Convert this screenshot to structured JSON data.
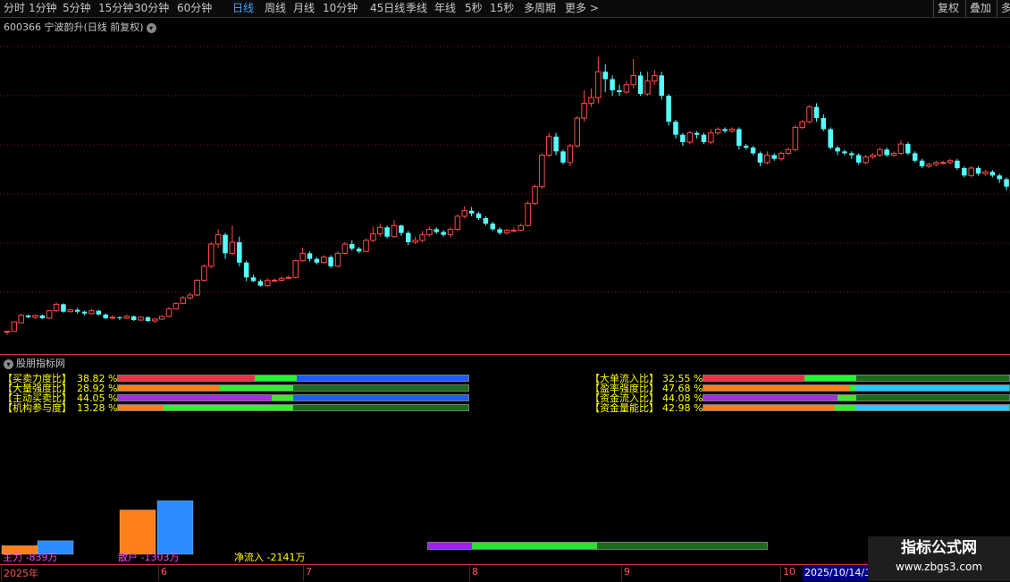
{
  "toolbar": {
    "periods": [
      {
        "label": "分时"
      },
      {
        "label": "1分钟"
      },
      {
        "label": "5分钟"
      },
      {
        "label": "15分钟"
      },
      {
        "label": "30分钟"
      },
      {
        "label": "60分钟"
      },
      {
        "label": "日线",
        "active": true
      },
      {
        "label": "周线"
      },
      {
        "label": "月线"
      },
      {
        "label": "10分钟"
      },
      {
        "label": "45日线"
      },
      {
        "label": "季线"
      },
      {
        "label": "年线"
      },
      {
        "label": "5秒"
      },
      {
        "label": "15秒"
      },
      {
        "label": "多周期"
      },
      {
        "label": "更多 >"
      }
    ],
    "right_buttons": [
      {
        "label": "复权"
      },
      {
        "label": "叠加"
      },
      {
        "label": "多"
      }
    ]
  },
  "chart": {
    "title": "600366 宁波韵升(日线 前复权)",
    "up_color": "#ff4a4a",
    "down_color": "#54ffff",
    "grid_color": "#7a1a1a"
  },
  "indicator_panel": {
    "title": "股朋指标网",
    "left_rows": [
      {
        "label": "【买卖力度比】",
        "value": "38.82 %",
        "segments": [
          {
            "pct": 39,
            "color": "#e8334a"
          },
          {
            "pct": 12,
            "color": "#33ee33"
          },
          {
            "pct": 49,
            "color": "#1e5eff"
          }
        ]
      },
      {
        "label": "【大量强度比】",
        "value": "28.92 %",
        "segments": [
          {
            "pct": 29,
            "color": "#ff7f1a"
          },
          {
            "pct": 21,
            "color": "#33ee33"
          },
          {
            "pct": 50,
            "color": "#1a6b1a"
          }
        ]
      },
      {
        "label": "【主动买卖比】",
        "value": "44.05 %",
        "segments": [
          {
            "pct": 44,
            "color": "#a030e0"
          },
          {
            "pct": 6,
            "color": "#33ee33"
          },
          {
            "pct": 50,
            "color": "#1e5eff"
          }
        ]
      },
      {
        "label": "【机构参与度】",
        "value": "13.28 %",
        "segments": [
          {
            "pct": 13,
            "color": "#ff7f1a"
          },
          {
            "pct": 37,
            "color": "#33ee33"
          },
          {
            "pct": 50,
            "color": "#1a6b1a"
          }
        ]
      }
    ],
    "right_rows": [
      {
        "label": "【大单流入比】",
        "value": "32.55 %",
        "segments": [
          {
            "pct": 33,
            "color": "#e8334a"
          },
          {
            "pct": 17,
            "color": "#33ee33"
          },
          {
            "pct": 50,
            "color": "#1a6b1a"
          }
        ]
      },
      {
        "label": "【盈率强度比】",
        "value": "47.68 %",
        "segments": [
          {
            "pct": 48,
            "color": "#ff7f1a"
          },
          {
            "pct": 2,
            "color": "#33ee33"
          },
          {
            "pct": 50,
            "color": "#22ccff"
          }
        ]
      },
      {
        "label": "【资金流入比】",
        "value": "44.08 %",
        "segments": [
          {
            "pct": 44,
            "color": "#a030e0"
          },
          {
            "pct": 6,
            "color": "#33ee33"
          },
          {
            "pct": 50,
            "color": "#1a6b1a"
          }
        ]
      },
      {
        "label": "【资金量能比】",
        "value": "42.98 %",
        "segments": [
          {
            "pct": 43,
            "color": "#ff7f1a"
          },
          {
            "pct": 7,
            "color": "#33ee33"
          },
          {
            "pct": 50,
            "color": "#22ccff"
          }
        ]
      }
    ],
    "flow_labels": {
      "main": "主力 -839万",
      "retail": "散户 -1303万",
      "net": "净流入 -2141万"
    },
    "bottom_bar_segments": [
      {
        "pct": 13,
        "color": "#a020f0"
      },
      {
        "pct": 37,
        "color": "#33dd33"
      },
      {
        "pct": 50,
        "color": "#1a6b1a"
      }
    ]
  },
  "date_axis": {
    "labels": [
      {
        "text": "2025年"
      },
      {
        "text": "6"
      },
      {
        "text": "7"
      },
      {
        "text": "8"
      },
      {
        "text": "9"
      },
      {
        "text": "10"
      }
    ],
    "active_label": "2025/10/14/二"
  },
  "watermark": {
    "title": "指标公式网",
    "url": "www.zbgs3.com"
  },
  "chart_data": {
    "type": "candlestick",
    "candles": [
      [
        0,
        19.75,
        19.8,
        19.8,
        19.6
      ],
      [
        1,
        19.8,
        20.3,
        20.3,
        19.8
      ],
      [
        2,
        20.25,
        20.65,
        20.75,
        20.25
      ],
      [
        3,
        20.65,
        20.55,
        20.7,
        20.5
      ],
      [
        4,
        20.55,
        20.65,
        20.7,
        20.45
      ],
      [
        5,
        20.65,
        20.5,
        20.7,
        20.45
      ],
      [
        6,
        20.5,
        20.9,
        20.95,
        20.45
      ],
      [
        7,
        20.9,
        21.25,
        21.35,
        20.85
      ],
      [
        8,
        21.25,
        20.85,
        21.3,
        20.8
      ],
      [
        9,
        20.85,
        20.95,
        21.0,
        20.8
      ],
      [
        10,
        20.95,
        20.85,
        21.05,
        20.75
      ],
      [
        11,
        20.85,
        20.75,
        20.9,
        20.65
      ],
      [
        12,
        20.75,
        20.9,
        21.0,
        20.7
      ],
      [
        13,
        20.9,
        20.7,
        20.95,
        20.65
      ],
      [
        14,
        20.7,
        20.5,
        20.75,
        20.45
      ],
      [
        15,
        20.5,
        20.55,
        20.65,
        20.45
      ],
      [
        16,
        20.55,
        20.5,
        20.6,
        20.4
      ],
      [
        17,
        20.5,
        20.6,
        20.7,
        20.45
      ],
      [
        18,
        20.6,
        20.4,
        20.65,
        20.35
      ],
      [
        19,
        20.4,
        20.55,
        20.6,
        20.35
      ],
      [
        20,
        20.55,
        20.35,
        20.6,
        20.3
      ],
      [
        21,
        20.35,
        20.45,
        20.5,
        20.25
      ],
      [
        22,
        20.45,
        20.6,
        20.65,
        20.4
      ],
      [
        23,
        20.6,
        21.0,
        21.1,
        20.55
      ],
      [
        24,
        21.0,
        21.3,
        21.35,
        20.95
      ],
      [
        25,
        21.3,
        21.6,
        21.7,
        21.25
      ],
      [
        26,
        21.6,
        21.75,
        21.85,
        21.5
      ],
      [
        27,
        21.75,
        22.55,
        22.6,
        21.7
      ],
      [
        28,
        22.55,
        23.3,
        23.4,
        22.5
      ],
      [
        29,
        23.3,
        24.5,
        24.6,
        23.2
      ],
      [
        30,
        24.5,
        25.0,
        25.3,
        24.3
      ],
      [
        31,
        25.0,
        24.0,
        25.1,
        23.7
      ],
      [
        32,
        24.0,
        24.6,
        25.5,
        23.9
      ],
      [
        33,
        24.6,
        23.5,
        24.9,
        23.3
      ],
      [
        34,
        23.5,
        22.7,
        23.6,
        22.5
      ],
      [
        35,
        22.7,
        22.5,
        22.85,
        22.45
      ],
      [
        36,
        22.5,
        22.25,
        22.6,
        22.2
      ],
      [
        37,
        22.25,
        22.55,
        22.65,
        22.2
      ],
      [
        38,
        22.55,
        22.55,
        22.65,
        22.45
      ],
      [
        39,
        22.55,
        22.65,
        22.75,
        22.5
      ],
      [
        40,
        22.65,
        22.7,
        22.8,
        22.6
      ],
      [
        41,
        22.7,
        23.6,
        23.65,
        22.65
      ],
      [
        42,
        23.6,
        24.0,
        24.3,
        23.55
      ],
      [
        43,
        24.0,
        23.7,
        24.1,
        23.55
      ],
      [
        44,
        23.7,
        23.5,
        23.8,
        23.4
      ],
      [
        45,
        23.5,
        23.8,
        23.9,
        23.45
      ],
      [
        46,
        23.8,
        23.3,
        23.9,
        23.2
      ],
      [
        47,
        23.3,
        24.0,
        24.1,
        23.25
      ],
      [
        48,
        24.0,
        24.5,
        24.6,
        23.95
      ],
      [
        49,
        24.5,
        24.25,
        24.7,
        24.15
      ],
      [
        50,
        24.25,
        24.1,
        24.35,
        24.0
      ],
      [
        51,
        24.1,
        24.7,
        24.8,
        24.05
      ],
      [
        52,
        24.7,
        25.05,
        25.45,
        24.6
      ],
      [
        53,
        25.05,
        25.4,
        25.6,
        24.9
      ],
      [
        54,
        25.4,
        24.9,
        25.5,
        24.8
      ],
      [
        55,
        24.9,
        25.5,
        25.8,
        24.85
      ],
      [
        56,
        25.5,
        25.1,
        25.55,
        24.95
      ],
      [
        57,
        25.1,
        24.6,
        25.2,
        24.45
      ],
      [
        58,
        24.6,
        24.7,
        24.9,
        24.5
      ],
      [
        59,
        24.7,
        25.0,
        25.2,
        24.6
      ],
      [
        60,
        25.0,
        25.3,
        25.45,
        24.9
      ],
      [
        61,
        25.3,
        25.15,
        25.4,
        25.05
      ],
      [
        62,
        25.15,
        25.0,
        25.25,
        24.9
      ],
      [
        63,
        25.0,
        25.3,
        25.4,
        24.85
      ],
      [
        64,
        25.3,
        26.0,
        26.1,
        25.2
      ],
      [
        65,
        26.0,
        26.3,
        26.55,
        25.9
      ],
      [
        66,
        26.3,
        26.15,
        26.5,
        26.0
      ],
      [
        67,
        26.15,
        25.9,
        26.25,
        25.8
      ],
      [
        68,
        25.9,
        25.6,
        26.0,
        25.5
      ],
      [
        69,
        25.6,
        25.3,
        25.7,
        25.2
      ],
      [
        70,
        25.3,
        25.1,
        25.4,
        25.0
      ],
      [
        71,
        25.1,
        25.25,
        25.3,
        25.0
      ],
      [
        72,
        25.25,
        25.25,
        25.4,
        25.15
      ],
      [
        73,
        25.25,
        25.5,
        25.6,
        25.2
      ],
      [
        74,
        25.5,
        26.7,
        26.8,
        25.45
      ],
      [
        75,
        26.7,
        27.6,
        27.7,
        26.6
      ],
      [
        76,
        27.6,
        29.3,
        29.4,
        27.5
      ],
      [
        77,
        29.3,
        30.3,
        30.5,
        29.2
      ],
      [
        78,
        30.3,
        29.5,
        30.5,
        29.3
      ],
      [
        79,
        29.5,
        28.9,
        29.6,
        28.8
      ],
      [
        80,
        28.9,
        29.8,
        29.9,
        28.7
      ],
      [
        81,
        29.8,
        31.3,
        31.4,
        29.7
      ],
      [
        82,
        31.3,
        32.1,
        32.8,
        31.1
      ],
      [
        83,
        32.1,
        32.4,
        32.9,
        31.9
      ],
      [
        84,
        32.4,
        33.8,
        34.6,
        32.1
      ],
      [
        85,
        33.8,
        33.4,
        34.2,
        32.7
      ],
      [
        86,
        33.4,
        32.8,
        33.6,
        32.5
      ],
      [
        87,
        32.8,
        32.7,
        33.1,
        32.5
      ],
      [
        88,
        32.7,
        33.1,
        33.3,
        32.6
      ],
      [
        89,
        33.1,
        33.6,
        34.5,
        32.9
      ],
      [
        90,
        33.6,
        32.6,
        33.8,
        32.5
      ],
      [
        91,
        32.6,
        33.3,
        33.8,
        32.5
      ],
      [
        92,
        33.3,
        33.6,
        33.9,
        33.1
      ],
      [
        93,
        33.6,
        32.5,
        33.8,
        32.3
      ],
      [
        94,
        32.5,
        31.1,
        32.6,
        30.9
      ],
      [
        95,
        31.1,
        30.4,
        31.2,
        30.2
      ],
      [
        96,
        30.4,
        30.0,
        30.5,
        29.8
      ],
      [
        97,
        30.0,
        30.5,
        30.6,
        29.9
      ],
      [
        98,
        30.5,
        30.4,
        30.6,
        30.2
      ],
      [
        99,
        30.4,
        30.0,
        30.5,
        29.9
      ],
      [
        100,
        30.0,
        30.5,
        30.7,
        29.9
      ],
      [
        101,
        30.5,
        30.7,
        30.8,
        30.4
      ],
      [
        102,
        30.7,
        30.6,
        30.8,
        30.5
      ],
      [
        103,
        30.6,
        30.7,
        30.8,
        30.5
      ],
      [
        104,
        30.7,
        29.8,
        30.8,
        29.6
      ],
      [
        105,
        29.8,
        29.7,
        29.9,
        29.6
      ],
      [
        106,
        29.7,
        29.4,
        29.8,
        29.3
      ],
      [
        107,
        29.4,
        28.9,
        29.5,
        28.7
      ],
      [
        108,
        28.9,
        29.3,
        29.5,
        28.8
      ],
      [
        109,
        29.3,
        29.1,
        29.4,
        29.0
      ],
      [
        110,
        29.1,
        29.4,
        29.5,
        29.0
      ],
      [
        111,
        29.4,
        29.6,
        29.7,
        29.3
      ],
      [
        112,
        29.6,
        30.8,
        30.9,
        29.5
      ],
      [
        113,
        30.8,
        31.1,
        31.2,
        30.7
      ],
      [
        114,
        31.1,
        31.9,
        32.0,
        31.0
      ],
      [
        115,
        31.9,
        31.3,
        32.1,
        31.1
      ],
      [
        116,
        31.3,
        30.7,
        31.5,
        30.6
      ],
      [
        117,
        30.7,
        29.7,
        30.8,
        29.6
      ],
      [
        118,
        29.7,
        29.5,
        29.8,
        29.3
      ],
      [
        119,
        29.5,
        29.4,
        29.6,
        29.3
      ],
      [
        120,
        29.4,
        29.3,
        29.5,
        29.1
      ],
      [
        121,
        29.3,
        28.9,
        29.4,
        28.8
      ],
      [
        122,
        28.9,
        29.2,
        29.3,
        28.8
      ],
      [
        123,
        29.2,
        29.3,
        29.4,
        29.1
      ],
      [
        124,
        29.3,
        29.6,
        29.7,
        29.2
      ],
      [
        125,
        29.6,
        29.3,
        29.7,
        29.2
      ],
      [
        126,
        29.3,
        29.4,
        29.5,
        29.2
      ],
      [
        127,
        29.4,
        29.9,
        30.1,
        29.3
      ],
      [
        128,
        29.9,
        29.4,
        30.0,
        29.3
      ],
      [
        129,
        29.4,
        29.0,
        29.5,
        28.9
      ],
      [
        130,
        29.0,
        28.7,
        29.1,
        28.6
      ],
      [
        131,
        28.7,
        28.8,
        28.9,
        28.6
      ],
      [
        132,
        28.8,
        28.9,
        29.0,
        28.7
      ],
      [
        133,
        28.9,
        28.9,
        29.0,
        28.8
      ],
      [
        134,
        28.9,
        29.0,
        29.1,
        28.8
      ],
      [
        135,
        29.0,
        28.6,
        29.1,
        28.5
      ],
      [
        136,
        28.6,
        28.2,
        28.7,
        28.1
      ],
      [
        137,
        28.2,
        28.6,
        28.7,
        28.1
      ],
      [
        138,
        28.6,
        28.3,
        28.7,
        28.2
      ],
      [
        139,
        28.3,
        28.4,
        28.5,
        28.2
      ],
      [
        140,
        28.4,
        28.2,
        28.5,
        28.1
      ],
      [
        141,
        28.2,
        28.0,
        28.3,
        27.8
      ],
      [
        142,
        28.0,
        27.6,
        28.1,
        27.4
      ]
    ],
    "y_range": [
      19.0,
      35.5
    ],
    "grid": true,
    "flow_bars": [
      {
        "name": "主力流入",
        "value": 1200,
        "color": "#ff7f1a"
      },
      {
        "name": "主力流出",
        "value": 1900,
        "color": "#2a8cff"
      },
      {
        "name": "散户流入",
        "value": 6200,
        "color": "#ff7f1a"
      },
      {
        "name": "散户流出",
        "value": 7500,
        "color": "#2a8cff"
      },
      {
        "name": "净流入",
        "value": 2141,
        "color": "#188a3a"
      }
    ]
  }
}
